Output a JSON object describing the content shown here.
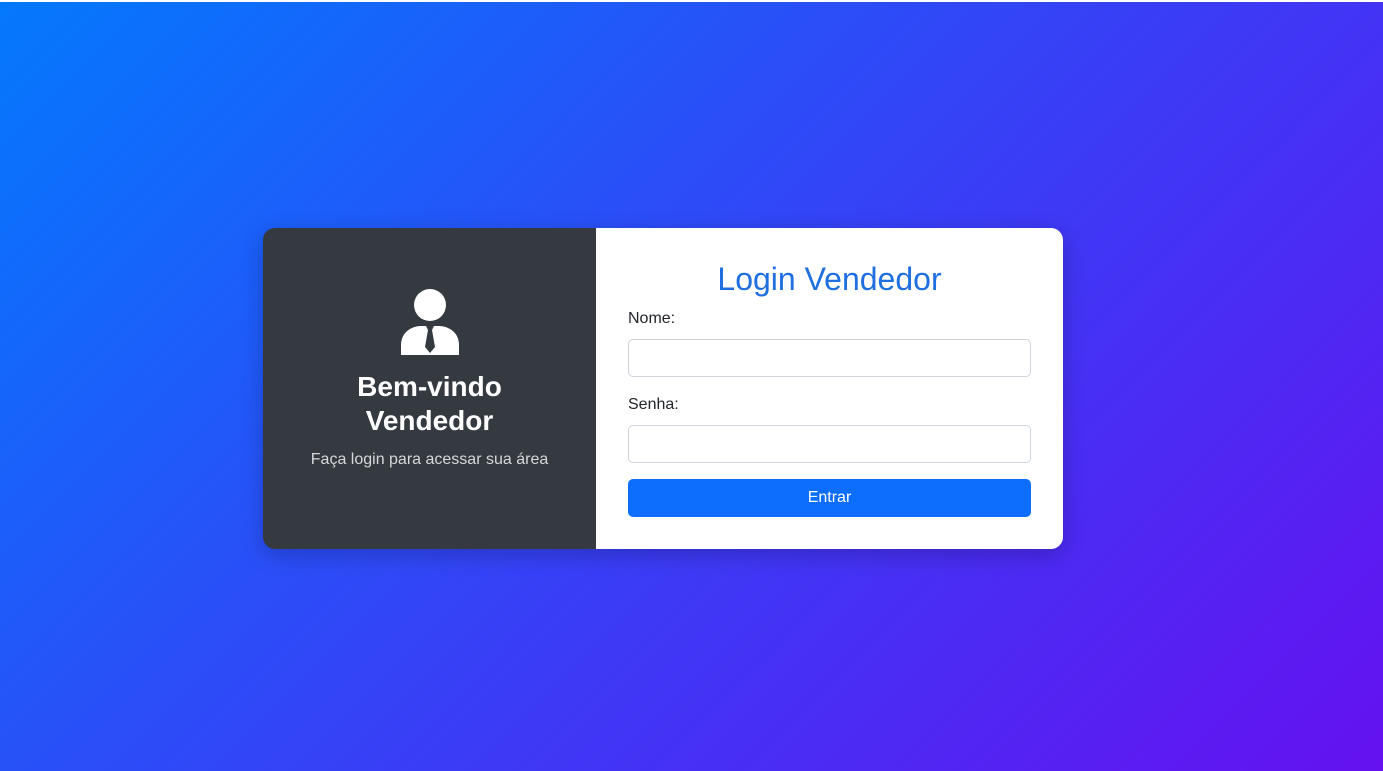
{
  "welcome_panel": {
    "icon": "user-tie-icon",
    "title": "Bem-vindo Vendedor",
    "subtitle": "Faça login para acessar sua área"
  },
  "login_form": {
    "title": "Login Vendedor",
    "name_label": "Nome:",
    "name_value": "",
    "password_label": "Senha:",
    "password_value": "",
    "submit_label": "Entrar"
  },
  "colors": {
    "background_gradient": [
      "#0479fd",
      "#6511f0"
    ],
    "left_panel": "#343a40",
    "title_color": "#1f6fe0",
    "button": "#0d6efd"
  }
}
